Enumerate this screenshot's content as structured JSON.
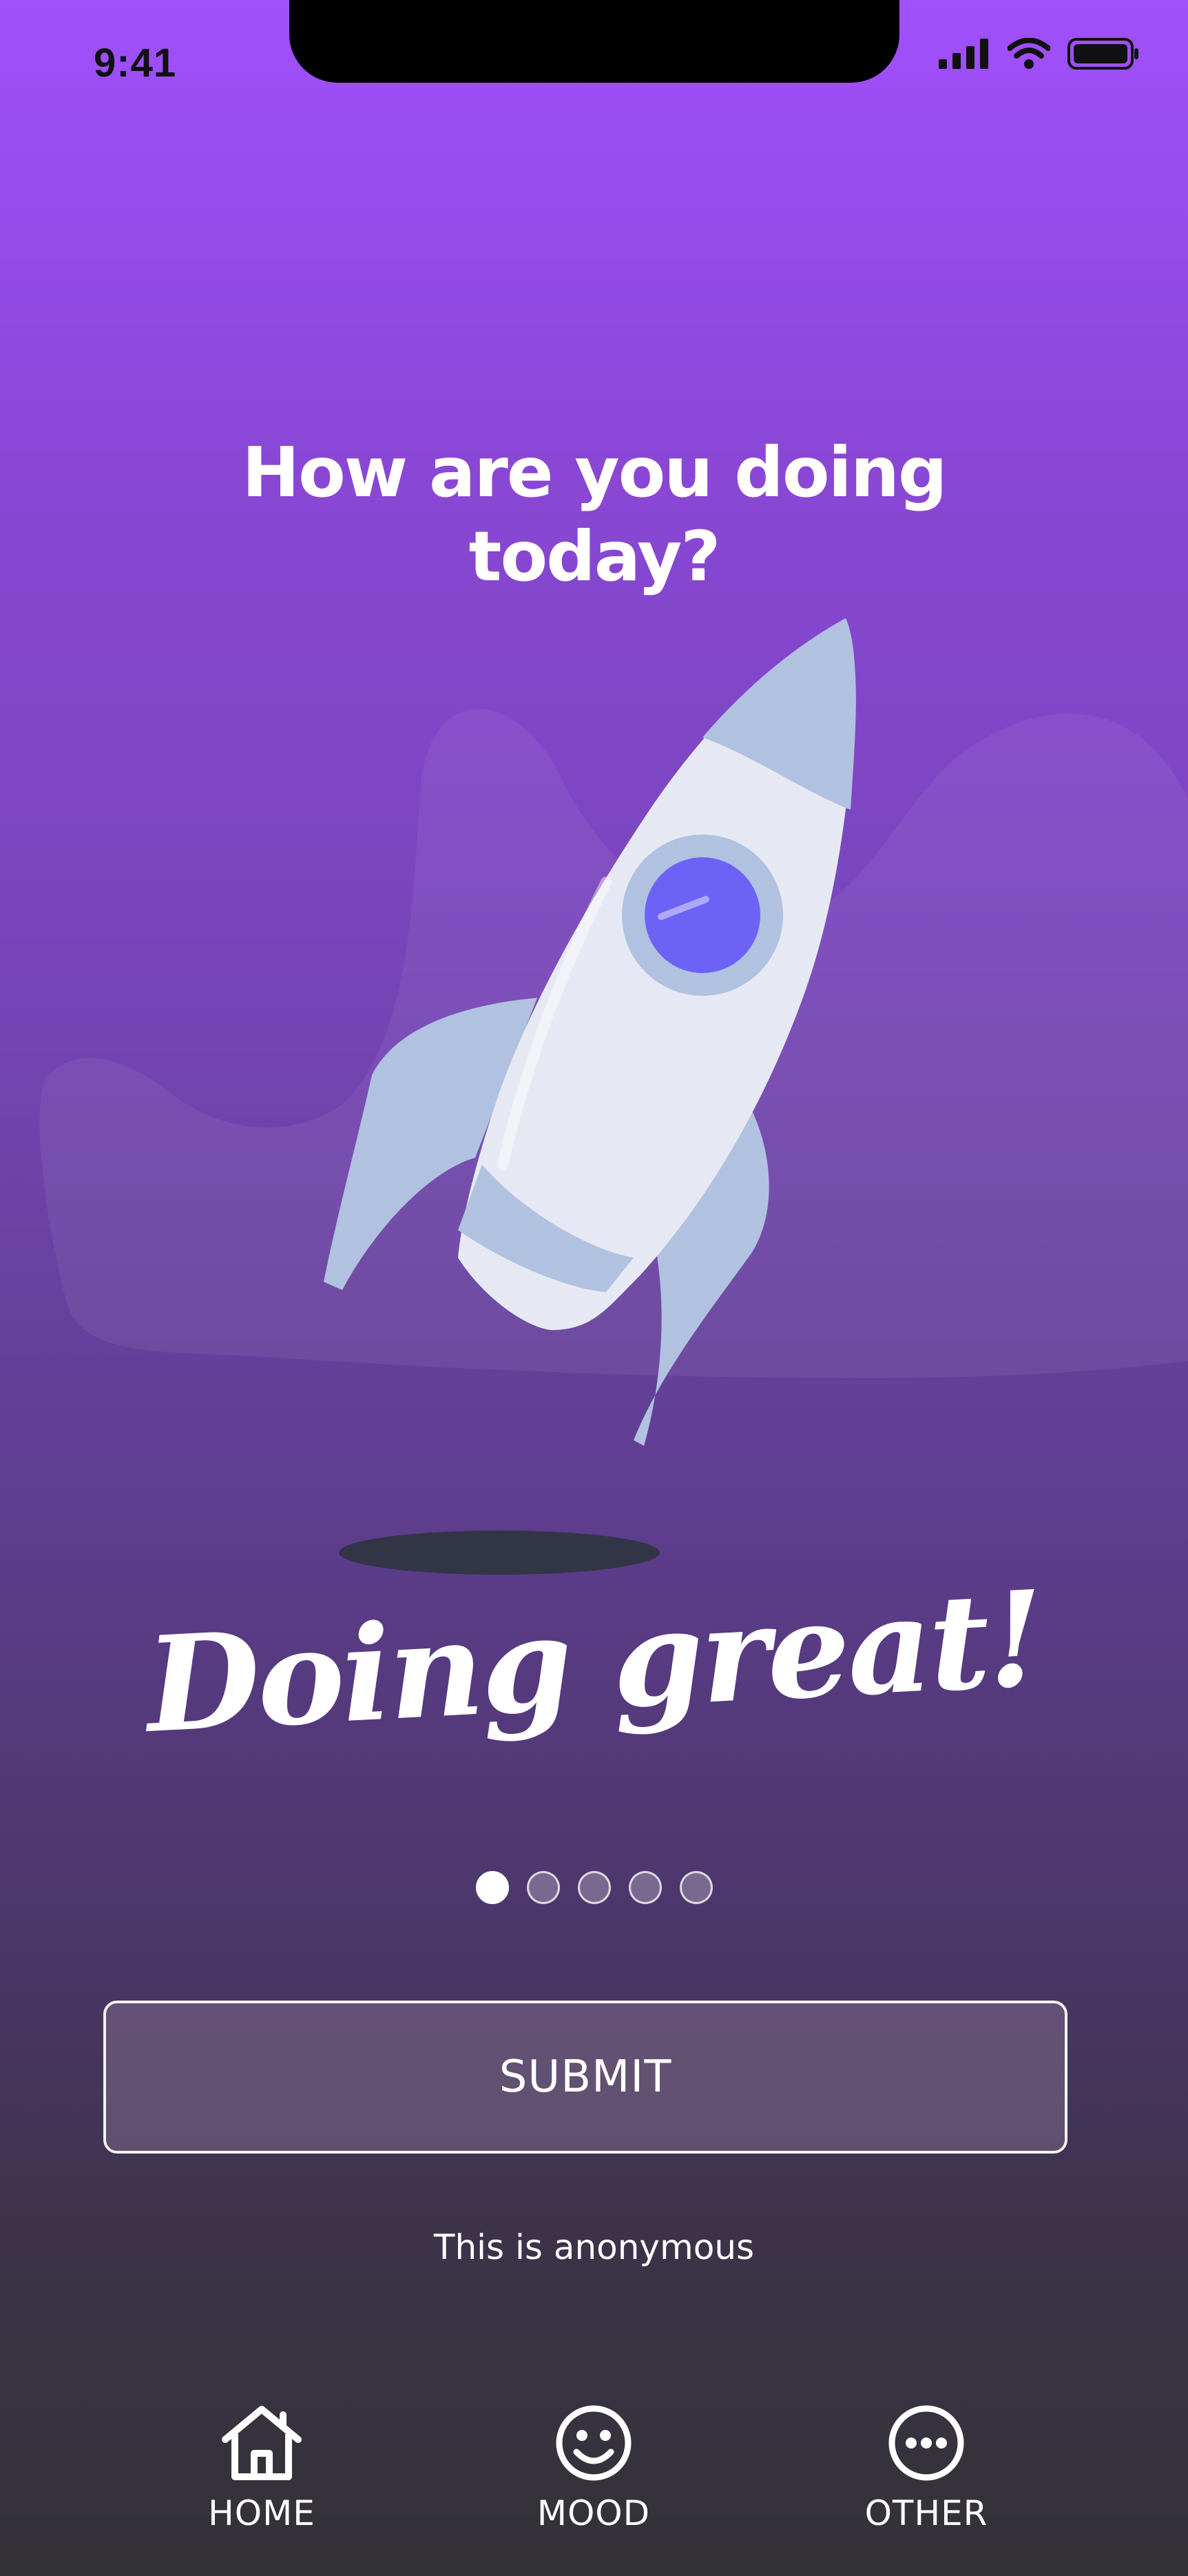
{
  "status_bar": {
    "time": "9:41",
    "icons": [
      "cellular-signal-icon",
      "wifi-icon",
      "battery-icon"
    ]
  },
  "headline": "How are you doing today?",
  "illustration": {
    "name": "rocket-illustration"
  },
  "mood": {
    "label": "Doing great!",
    "pages_total": 5,
    "page_active": 1
  },
  "submit_label": "SUBMIT",
  "anonymous_note": "This is anonymous",
  "tab_bar": {
    "items": [
      {
        "label": "HOME",
        "icon": "home-icon"
      },
      {
        "label": "MOOD",
        "icon": "smiley-icon"
      },
      {
        "label": "OTHER",
        "icon": "more-dots-icon"
      }
    ]
  },
  "colors": {
    "gradient_top": "#a150fc",
    "gradient_bottom": "#333236",
    "rocket_body": "#e6e9f3",
    "rocket_accent": "#b1c1e0",
    "rocket_window": "#6c63f6",
    "shadow": "#323546"
  }
}
